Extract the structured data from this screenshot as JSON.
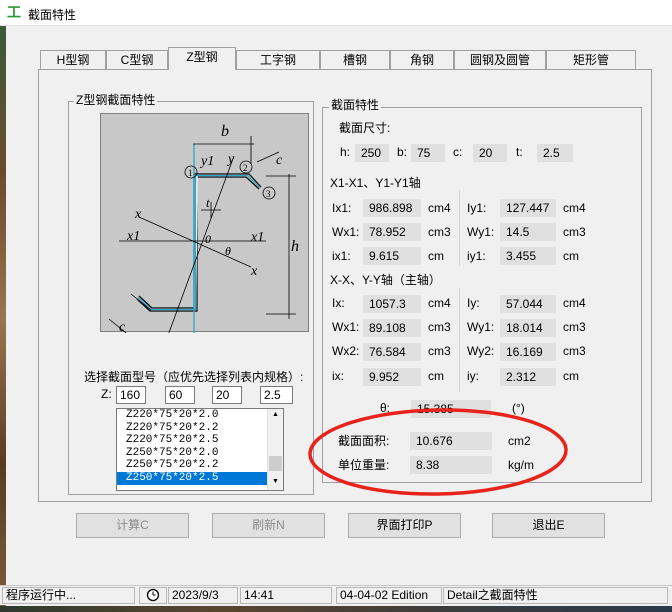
{
  "window": {
    "title": "截面特性",
    "icon": "I-beam-icon"
  },
  "tabs": [
    {
      "label": "H型钢",
      "active": false
    },
    {
      "label": "C型钢",
      "active": false
    },
    {
      "label": "Z型钢",
      "active": true
    },
    {
      "label": "工字钢",
      "active": false
    },
    {
      "label": "槽钢",
      "active": false
    },
    {
      "label": "角钢",
      "active": false
    },
    {
      "label": "圆钢及圆管",
      "active": false
    },
    {
      "label": "矩形管",
      "active": false
    }
  ],
  "left_group": {
    "title": "Z型钢截面特性",
    "diagram_labels": {
      "b": "b",
      "y1_top": "y1",
      "y_top": "y",
      "c_top": "c",
      "t": "t",
      "x": "x",
      "x1_left": "x1",
      "o": "0",
      "x1_right": "x1",
      "theta": "θ",
      "x_right": "x",
      "h": "h",
      "y_bottom": "y",
      "y1_bottom": "y1",
      "c_bottom": "c",
      "n1": "1",
      "n2": "2",
      "n3": "3"
    },
    "select_label": "选择截面型号（应优先选择列表内规格）:",
    "z_label": "Z:",
    "inputs": [
      "160",
      "60",
      "20",
      "2.5"
    ],
    "list_items": [
      "Z220*75*20*2.0",
      "Z220*75*20*2.2",
      "Z220*75*20*2.5",
      "Z250*75*20*2.0",
      "Z250*75*20*2.2",
      "Z250*75*20*2.5"
    ],
    "selected_index": 5
  },
  "right_group": {
    "title": "截面特性",
    "dims_title": "截面尺寸:",
    "dims": [
      {
        "label": "h:",
        "value": "250"
      },
      {
        "label": "b:",
        "value": "75"
      },
      {
        "label": "c:",
        "value": "20"
      },
      {
        "label": "t:",
        "value": "2.5"
      }
    ],
    "axis1_title": "X1-X1、Y1-Y1轴",
    "axis1_left": [
      {
        "label": "Ix1:",
        "value": "986.898",
        "unit": "cm4"
      },
      {
        "label": "Wx1:",
        "value": "78.952",
        "unit": "cm3"
      },
      {
        "label": "ix1:",
        "value": "9.615",
        "unit": "cm"
      }
    ],
    "axis1_right": [
      {
        "label": "Iy1:",
        "value": "127.447",
        "unit": "cm4"
      },
      {
        "label": "Wy1:",
        "value": "14.5",
        "unit": "cm3"
      },
      {
        "label": "iy1:",
        "value": "3.455",
        "unit": "cm"
      }
    ],
    "axis2_title": "X-X、Y-Y轴（主轴）",
    "axis2_left": [
      {
        "label": "Ix:",
        "value": "1057.3",
        "unit": "cm4"
      },
      {
        "label": "Wx1:",
        "value": "89.108",
        "unit": "cm3"
      },
      {
        "label": "Wx2:",
        "value": "76.584",
        "unit": "cm3"
      },
      {
        "label": "ix:",
        "value": "9.952",
        "unit": "cm"
      }
    ],
    "axis2_right": [
      {
        "label": "Iy:",
        "value": "57.044",
        "unit": "cm4"
      },
      {
        "label": "Wy1:",
        "value": "18.014",
        "unit": "cm3"
      },
      {
        "label": "Wy2:",
        "value": "16.169",
        "unit": "cm3"
      },
      {
        "label": "iy:",
        "value": "2.312",
        "unit": "cm"
      }
    ],
    "theta": {
      "label": "θ:",
      "value": "15.385",
      "unit": "(°)"
    },
    "area": {
      "label": "截面面积:",
      "value": "10.676",
      "unit": "cm2"
    },
    "weight": {
      "label": "单位重量:",
      "value": "8.38",
      "unit": "kg/m"
    },
    "annotation_color": "#e8231c"
  },
  "buttons": {
    "calc": "计算C",
    "refresh": "刷新N",
    "print": "界面打印P",
    "exit": "退出E"
  },
  "status": {
    "running": "程序运行中...",
    "date": "2023/9/3",
    "time": "14:41",
    "edition": "04-04-02 Edition",
    "detail": "Detail之截面特性"
  }
}
